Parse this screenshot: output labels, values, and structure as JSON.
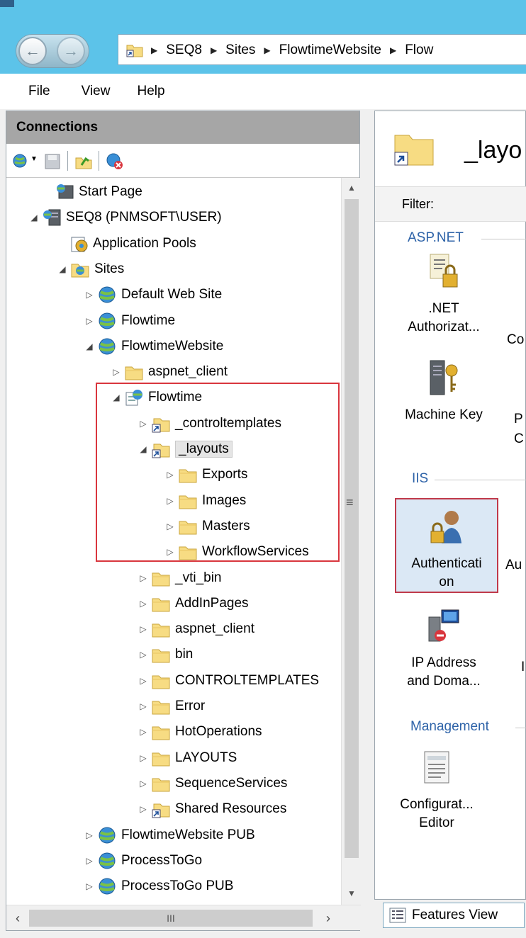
{
  "address": {
    "crumbs": [
      "SEQ8",
      "Sites",
      "FlowtimeWebsite",
      "Flow"
    ]
  },
  "menu": [
    "File",
    "View",
    "Help"
  ],
  "connections": {
    "header": "Connections"
  },
  "tree": [
    {
      "label": "Start Page",
      "icon": "start-page-icon",
      "expander": ""
    },
    {
      "label": "SEQ8 (PNMSOFT\\USER)",
      "icon": "server-icon",
      "expander": "◢"
    },
    {
      "label": "Application Pools",
      "icon": "app-pools-icon",
      "expander": ""
    },
    {
      "label": "Sites",
      "icon": "sites-folder-icon",
      "expander": "◢"
    },
    {
      "label": "Default Web Site",
      "icon": "globe-icon",
      "expander": "▷"
    },
    {
      "label": "Flowtime",
      "icon": "globe-icon",
      "expander": "▷"
    },
    {
      "label": "FlowtimeWebsite",
      "icon": "globe-icon",
      "expander": "◢"
    },
    {
      "label": "aspnet_client",
      "icon": "folder-icon",
      "expander": "▷"
    },
    {
      "label": "Flowtime",
      "icon": "application-icon",
      "expander": "◢"
    },
    {
      "label": "_controltemplates",
      "icon": "virtual-dir-icon",
      "expander": "▷"
    },
    {
      "label": "_layouts",
      "icon": "virtual-dir-icon",
      "expander": "◢",
      "selected": true
    },
    {
      "label": "Exports",
      "icon": "folder-icon",
      "expander": "▷"
    },
    {
      "label": "Images",
      "icon": "folder-icon",
      "expander": "▷"
    },
    {
      "label": "Masters",
      "icon": "folder-icon",
      "expander": "▷"
    },
    {
      "label": "WorkflowServices",
      "icon": "folder-icon",
      "expander": "▷"
    },
    {
      "label": "_vti_bin",
      "icon": "folder-icon",
      "expander": "▷"
    },
    {
      "label": "AddInPages",
      "icon": "folder-icon",
      "expander": "▷"
    },
    {
      "label": "aspnet_client",
      "icon": "folder-icon",
      "expander": "▷"
    },
    {
      "label": "bin",
      "icon": "folder-icon",
      "expander": "▷"
    },
    {
      "label": "CONTROLTEMPLATES",
      "icon": "folder-icon",
      "expander": "▷"
    },
    {
      "label": "Error",
      "icon": "folder-icon",
      "expander": "▷"
    },
    {
      "label": "HotOperations",
      "icon": "folder-icon",
      "expander": "▷"
    },
    {
      "label": "LAYOUTS",
      "icon": "folder-icon",
      "expander": "▷"
    },
    {
      "label": "SequenceServices",
      "icon": "folder-icon",
      "expander": "▷"
    },
    {
      "label": "Shared Resources",
      "icon": "virtual-dir-icon",
      "expander": "▷"
    },
    {
      "label": "FlowtimeWebsite PUB",
      "icon": "globe-icon",
      "expander": "▷"
    },
    {
      "label": "ProcessToGo",
      "icon": "globe-icon",
      "expander": "▷"
    },
    {
      "label": "ProcessToGo PUB",
      "icon": "globe-icon",
      "expander": "▷"
    }
  ],
  "right": {
    "title": "_layo",
    "filter_label": "Filter:",
    "groups": {
      "aspnet": "ASP.NET",
      "iis": "IIS",
      "management": "Management"
    },
    "features": {
      "net_auth_1": ".NET",
      "net_auth_2": "Authorizat...",
      "net_auth_partial": "Co",
      "machine_key": "Machine Key",
      "machine_key_partial_1": "P",
      "machine_key_partial_2": "C",
      "authentication_1": "Authenticati",
      "authentication_2": "on",
      "authentication_partial": "Au",
      "ip_1": "IP Address",
      "ip_2": "and Doma...",
      "ip_partial": "I",
      "config_1": "Configurat...",
      "config_2": "Editor"
    },
    "features_view_tab": "Features View"
  },
  "colors": {
    "titlebar": "#5cc3e9",
    "highlight": "#d9363e",
    "group_header": "#2e63a8",
    "selected_feature_bg": "#dbe8f5"
  }
}
